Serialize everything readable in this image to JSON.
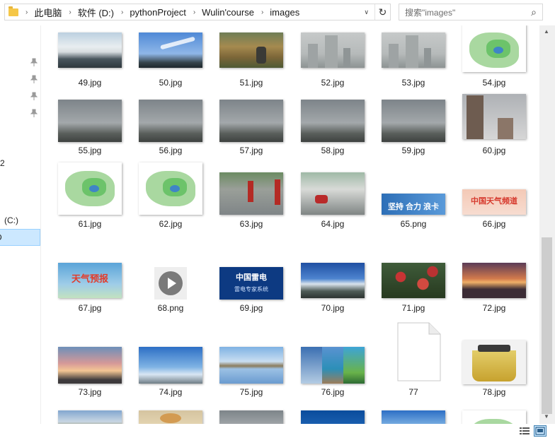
{
  "address": {
    "crumbs": [
      "此电脑",
      "软件 (D:)",
      "pythonProject",
      "Wulin'course",
      "images"
    ],
    "dropdown_glyph": "∨",
    "refresh_glyph": "↻"
  },
  "search": {
    "placeholder": "搜索\"images\"",
    "icon": "search-icon"
  },
  "nav": {
    "labels": [
      {
        "text": "2",
        "name": "nav-item-partial-1"
      },
      {
        "text": "(C:)",
        "name": "nav-item-drive-c"
      },
      {
        "text": "D",
        "name": "nav-item-drive-d"
      }
    ],
    "pins": 4
  },
  "files": [
    {
      "name": "49.jpg",
      "kind": "fog"
    },
    {
      "name": "50.jpg",
      "kind": "sky"
    },
    {
      "name": "51.jpg",
      "kind": "field"
    },
    {
      "name": "52.jpg",
      "kind": "haze"
    },
    {
      "name": "53.jpg",
      "kind": "haze"
    },
    {
      "name": "54.jpg",
      "kind": "map"
    },
    {
      "name": "55.jpg",
      "kind": "cloud"
    },
    {
      "name": "56.jpg",
      "kind": "cloud"
    },
    {
      "name": "57.jpg",
      "kind": "cloud"
    },
    {
      "name": "58.jpg",
      "kind": "cloud"
    },
    {
      "name": "59.jpg",
      "kind": "cloud"
    },
    {
      "name": "60.jpg",
      "kind": "tall"
    },
    {
      "name": "61.jpg",
      "kind": "map"
    },
    {
      "name": "62.jpg",
      "kind": "map"
    },
    {
      "name": "63.jpg",
      "kind": "rain"
    },
    {
      "name": "64.jpg",
      "kind": "rain2"
    },
    {
      "name": "65.png",
      "kind": "banner"
    },
    {
      "name": "66.jpg",
      "kind": "banner2"
    },
    {
      "name": "67.jpg",
      "kind": "poster"
    },
    {
      "name": "68.png",
      "kind": "play"
    },
    {
      "name": "69.jpg",
      "kind": "cma"
    },
    {
      "name": "70.jpg",
      "kind": "mountain"
    },
    {
      "name": "71.jpg",
      "kind": "flowers"
    },
    {
      "name": "72.jpg",
      "kind": "sunset"
    },
    {
      "name": "73.jpg",
      "kind": "dusk"
    },
    {
      "name": "74.jpg",
      "kind": "bluesky"
    },
    {
      "name": "75.jpg",
      "kind": "lake"
    },
    {
      "name": "76.jpg",
      "kind": "collage"
    },
    {
      "name": "77",
      "kind": "blank"
    },
    {
      "name": "78.jpg",
      "kind": "tea"
    },
    {
      "name": "",
      "kind": "land"
    },
    {
      "name": "",
      "kind": "food"
    },
    {
      "name": "",
      "kind": "cloud"
    },
    {
      "name": "",
      "kind": "sea"
    },
    {
      "name": "",
      "kind": "bluesky"
    },
    {
      "name": "",
      "kind": "map"
    }
  ],
  "banners": {
    "b65": "坚持 合力 浪卡",
    "b66": "中国天气频道",
    "b67": "天气预报",
    "b69_title": "中国雷电",
    "b69_sub": "雷电专家系统"
  }
}
